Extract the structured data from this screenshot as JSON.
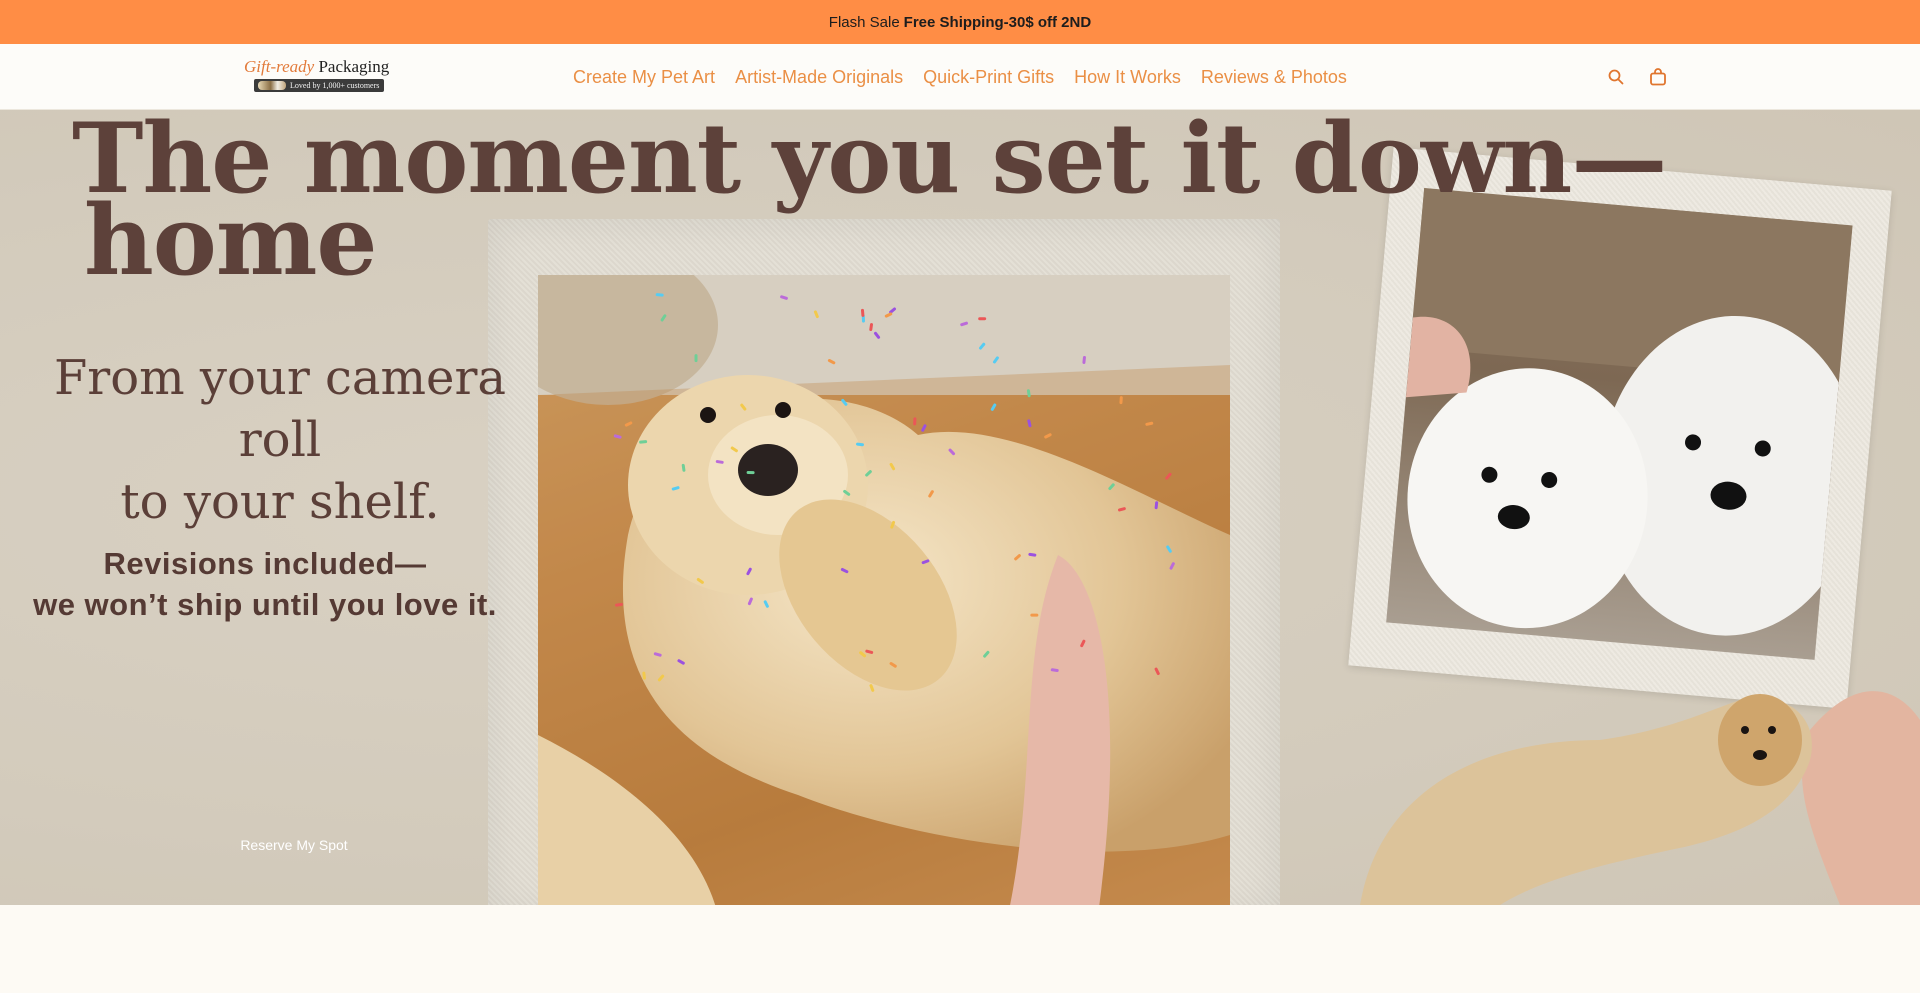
{
  "announcement": {
    "prefix": "Flash Sale",
    "highlight": "Free Shipping-30$ off 2ND"
  },
  "header": {
    "logo": {
      "word1": "Gift-ready",
      "word2": "Packaging",
      "badge": "Loved by 1,000+ customers"
    },
    "nav": [
      {
        "label": "Create My Pet Art"
      },
      {
        "label": "Artist-Made Originals"
      },
      {
        "label": "Quick-Print Gifts"
      },
      {
        "label": "How It Works"
      },
      {
        "label": "Reviews & Photos"
      }
    ],
    "icons": {
      "search": "search-icon",
      "cart": "shopping-bag-icon"
    }
  },
  "hero": {
    "headline_line1": "The moment you set it down—",
    "headline_line2": "home",
    "subhead_line1": "From your camera roll",
    "subhead_line2": "to your shelf.",
    "revisions_line1": "Revisions included—",
    "revisions_line2": "we won’t ship until you love it.",
    "cta_label": "Reserve My Spot"
  },
  "colors": {
    "announcement_bg": "#ff8d45",
    "nav_link": "#ea8f45",
    "headline": "#5d413a",
    "hero_bg": "#d5cdbf",
    "page_bg": "#fdfaf4"
  }
}
